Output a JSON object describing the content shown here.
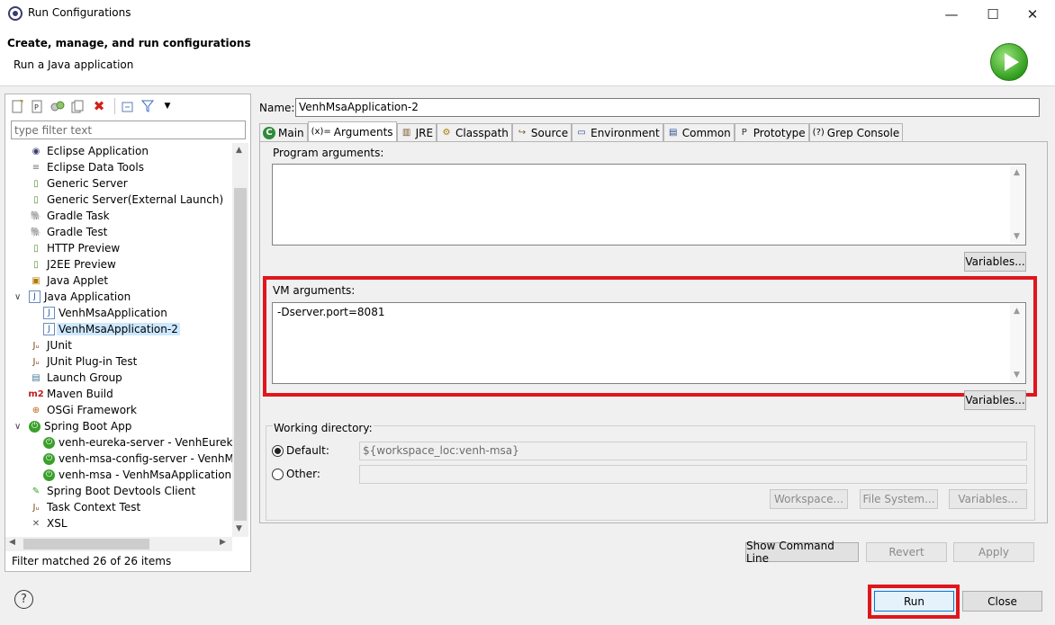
{
  "window": {
    "title": "Run Configurations",
    "minimize_glyph": "—",
    "maximize_glyph": "☐",
    "close_glyph": "✕"
  },
  "header": {
    "title": "Create, manage, and run configurations",
    "subtitle": "Run a Java application"
  },
  "left": {
    "filter_placeholder": "type filter text",
    "status": "Filter matched 26 of 26 items",
    "tree": [
      {
        "label": "Eclipse Application",
        "icon": "eclipse-icon",
        "level": 0
      },
      {
        "label": "Eclipse Data Tools",
        "icon": "database-icon",
        "level": 0
      },
      {
        "label": "Generic Server",
        "icon": "server-icon",
        "level": 0
      },
      {
        "label": "Generic Server(External Launch)",
        "icon": "server-icon",
        "level": 0
      },
      {
        "label": "Gradle Task",
        "icon": "gradle-icon",
        "level": 0
      },
      {
        "label": "Gradle Test",
        "icon": "gradle-icon",
        "level": 0
      },
      {
        "label": "HTTP Preview",
        "icon": "server-icon",
        "level": 0
      },
      {
        "label": "J2EE Preview",
        "icon": "server-icon",
        "level": 0
      },
      {
        "label": "Java Applet",
        "icon": "applet-icon",
        "level": 0
      },
      {
        "label": "Java Application",
        "icon": "java-app-icon",
        "level": 0,
        "expanded": true
      },
      {
        "label": "VenhMsaApplication",
        "icon": "java-app-icon",
        "level": 1
      },
      {
        "label": "VenhMsaApplication-2",
        "icon": "java-app-icon",
        "level": 1,
        "selected": true
      },
      {
        "label": "JUnit",
        "icon": "junit-icon",
        "level": 0
      },
      {
        "label": "JUnit Plug-in Test",
        "icon": "junit-plugin-icon",
        "level": 0
      },
      {
        "label": "Launch Group",
        "icon": "launch-group-icon",
        "level": 0
      },
      {
        "label": "Maven Build",
        "icon": "maven-icon",
        "level": 0
      },
      {
        "label": "OSGi Framework",
        "icon": "osgi-icon",
        "level": 0
      },
      {
        "label": "Spring Boot App",
        "icon": "spring-boot-icon",
        "level": 0,
        "expanded": true
      },
      {
        "label": "venh-eureka-server - VenhEurekaSe",
        "icon": "spring-boot-icon",
        "level": 1
      },
      {
        "label": "venh-msa-config-server - VenhMsa",
        "icon": "spring-boot-icon",
        "level": 1
      },
      {
        "label": "venh-msa - VenhMsaApplication",
        "icon": "spring-boot-icon",
        "level": 1
      },
      {
        "label": "Spring Boot Devtools Client",
        "icon": "spring-devtools-icon",
        "level": 0
      },
      {
        "label": "Task Context Test",
        "icon": "junit-icon",
        "level": 0
      },
      {
        "label": "XSL",
        "icon": "xsl-icon",
        "level": 0
      }
    ]
  },
  "right": {
    "name_label": "Name:",
    "name_value": "VenhMsaApplication-2",
    "tabs": [
      {
        "label": "Main",
        "icon": "main-tab-icon"
      },
      {
        "label": "Arguments",
        "icon": "arguments-tab-icon",
        "prefix": "(x)=",
        "active": true
      },
      {
        "label": "JRE",
        "icon": "jre-tab-icon"
      },
      {
        "label": "Classpath",
        "icon": "classpath-tab-icon"
      },
      {
        "label": "Source",
        "icon": "source-tab-icon"
      },
      {
        "label": "Environment",
        "icon": "environment-tab-icon"
      },
      {
        "label": "Common",
        "icon": "common-tab-icon"
      },
      {
        "label": "Prototype",
        "icon": "prototype-tab-icon"
      },
      {
        "label": "Grep Console",
        "icon": "grep-console-tab-icon",
        "prefix": "(?)"
      }
    ],
    "program_args_label": "Program arguments:",
    "program_args_value": "",
    "vm_args_label": "VM arguments:",
    "vm_args_value": "-Dserver.port=8081",
    "variables_label": "Variables...",
    "working_dir_label": "Working directory:",
    "default_label": "Default:",
    "default_value": "${workspace_loc:venh-msa}",
    "other_label": "Other:",
    "other_value": "",
    "workspace_btn": "Workspace...",
    "filesystem_btn": "File System...",
    "variables_btn2": "Variables...",
    "show_cmd_btn": "Show Command Line",
    "revert_btn": "Revert",
    "apply_btn": "Apply"
  },
  "bottom": {
    "help_glyph": "?",
    "run_btn": "Run",
    "close_btn": "Close"
  },
  "colors": {
    "highlight": "#e0161c",
    "selection": "#cce8ff"
  }
}
